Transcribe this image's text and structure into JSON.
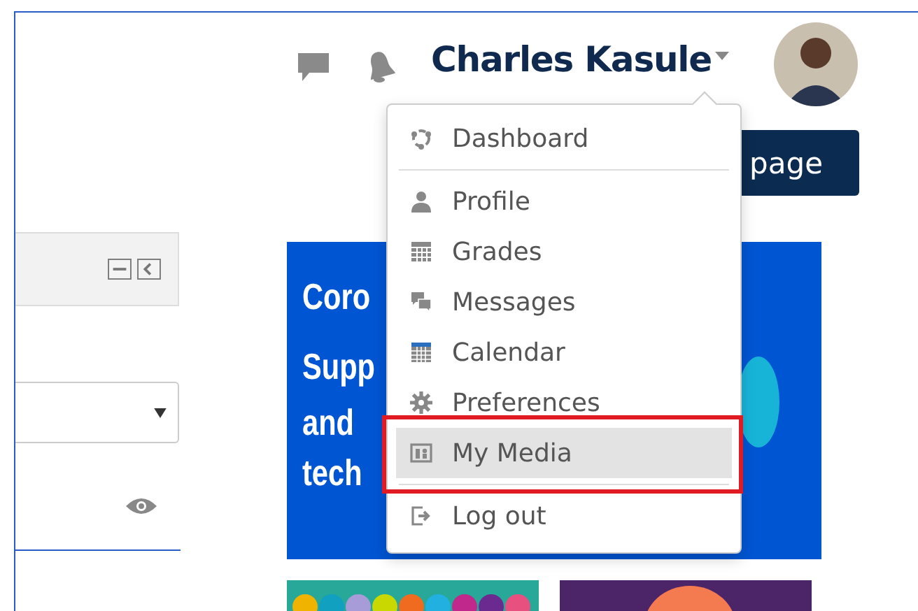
{
  "header": {
    "user_name": "Charles Kasule"
  },
  "page_button": {
    "label": "page"
  },
  "banner": {
    "lines": [
      "Coro",
      "Supp",
      "and",
      "tech"
    ]
  },
  "user_menu": {
    "items": [
      {
        "label": "Dashboard",
        "selected": false,
        "annotated": false,
        "divider_after": true
      },
      {
        "label": "Profile",
        "selected": false,
        "annotated": false,
        "divider_after": false
      },
      {
        "label": "Grades",
        "selected": false,
        "annotated": false,
        "divider_after": false
      },
      {
        "label": "Messages",
        "selected": false,
        "annotated": false,
        "divider_after": false
      },
      {
        "label": "Calendar",
        "selected": false,
        "annotated": false,
        "divider_after": false
      },
      {
        "label": "Preferences",
        "selected": false,
        "annotated": false,
        "divider_after": false
      },
      {
        "label": "My Media",
        "selected": true,
        "annotated": true,
        "divider_after": true
      },
      {
        "label": "Log out",
        "selected": false,
        "annotated": false,
        "divider_after": false
      }
    ]
  }
}
